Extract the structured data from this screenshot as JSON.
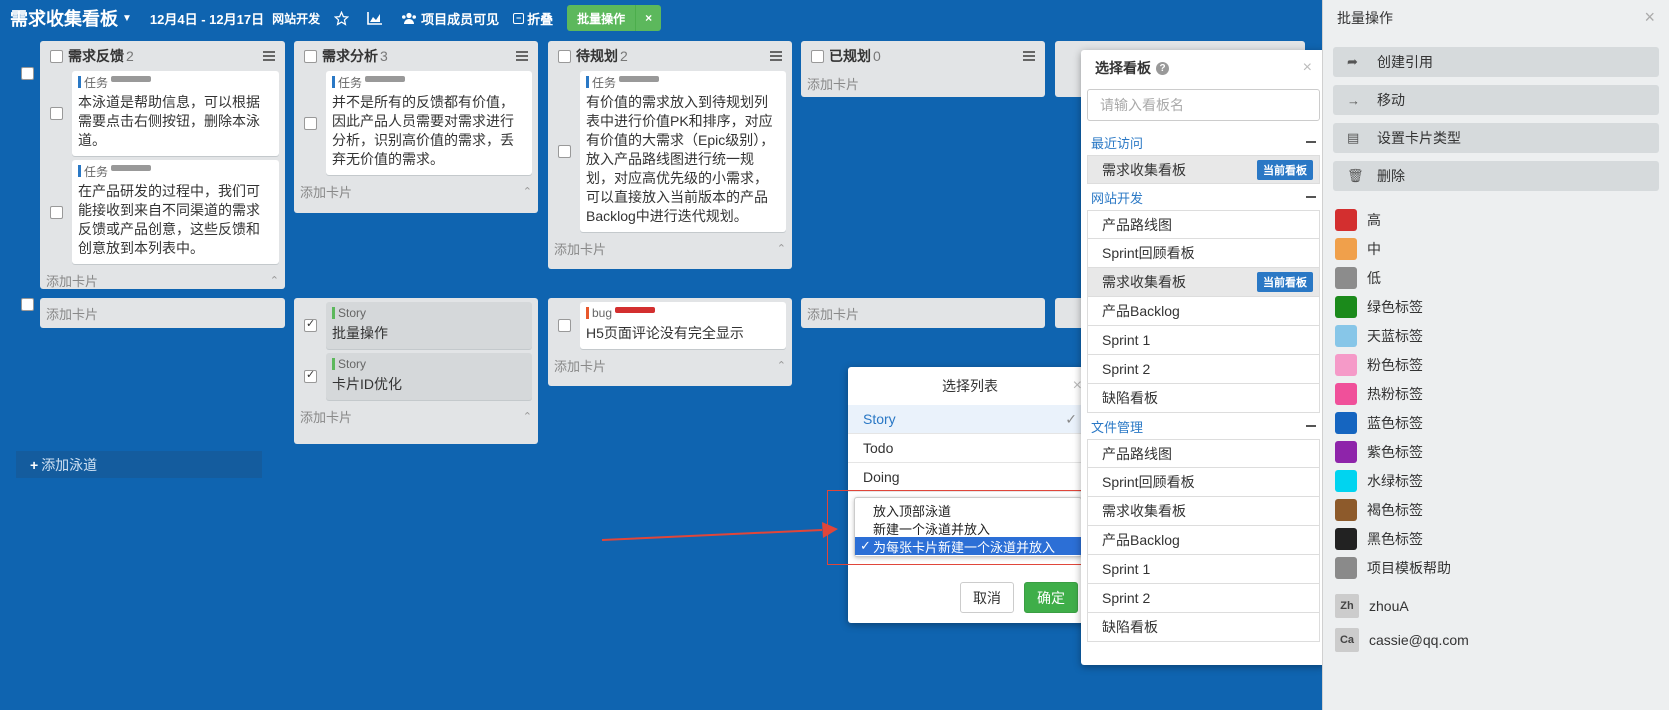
{
  "topbar": {
    "board_title": "需求收集看板",
    "date_range": "12月4日 - 12月17日",
    "project": "网站开发",
    "visibility": "项目成员可见",
    "collapse": "折叠",
    "batch_op": "批量操作",
    "close_batch": "×"
  },
  "lists": [
    {
      "title": "需求反馈",
      "count": "2"
    },
    {
      "title": "需求分析",
      "count": "3"
    },
    {
      "title": "待规划",
      "count": "2"
    },
    {
      "title": "已规划",
      "count": "0"
    }
  ],
  "cards": {
    "fb1": {
      "tag": "任务",
      "text": "本泳道是帮助信息，可以根据需要点击右侧按钮，删除本泳道。"
    },
    "fb2": {
      "tag": "任务",
      "text": "在产品研发的过程中，我们可能接收到来自不同渠道的需求反馈或产品创意，这些反馈和创意放到本列表中。"
    },
    "an1": {
      "tag": "任务",
      "text": "并不是所有的反馈都有价值，因此产品人员需要对需求进行分析，识别高价值的需求，丢弃无价值的需求。"
    },
    "pl1": {
      "tag": "任务",
      "text": "有价值的需求放入到待规划列表中进行价值PK和排序，对应有价值的大需求（Epic级别），放入产品路线图进行统一规划，对应高优先级的小需求，可以直接放入当前版本的产品Backlog中进行迭代规划。"
    },
    "an2": {
      "tag": "Story",
      "text": "批量操作"
    },
    "an3": {
      "tag": "Story",
      "text": "卡片ID优化"
    },
    "pl2": {
      "tag": "bug",
      "text": "H5页面评论没有完全显示"
    }
  },
  "add_card": "添加卡片",
  "add_lane": "添加泳道",
  "board_popup": {
    "title": "选择看板",
    "help": "?",
    "placeholder": "请输入看板名",
    "close": "×",
    "groups": [
      {
        "name": "最近访问",
        "boards": [
          {
            "name": "需求收集看板",
            "badge": "当前看板"
          }
        ]
      },
      {
        "name": "网站开发",
        "boards": [
          {
            "name": "产品路线图"
          },
          {
            "name": "Sprint回顾看板"
          },
          {
            "name": "需求收集看板",
            "badge": "当前看板"
          },
          {
            "name": "产品Backlog"
          },
          {
            "name": "Sprint 1"
          },
          {
            "name": "Sprint 2"
          },
          {
            "name": "缺陷看板"
          }
        ]
      },
      {
        "name": "文件管理",
        "boards": [
          {
            "name": "产品路线图"
          },
          {
            "name": "Sprint回顾看板"
          },
          {
            "name": "需求收集看板"
          },
          {
            "name": "产品Backlog"
          },
          {
            "name": "Sprint 1"
          },
          {
            "name": "Sprint 2"
          },
          {
            "name": "缺陷看板"
          }
        ]
      }
    ]
  },
  "list_dialog": {
    "title": "选择列表",
    "close": "×",
    "options": [
      "Story",
      "Todo",
      "Doing"
    ],
    "selected_option": "Story",
    "lane_choices": [
      "放入顶部泳道",
      "新建一个泳道并放入",
      "为每张卡片新建一个泳道并放入"
    ],
    "lane_selected": "为每张卡片新建一个泳道并放入",
    "cancel": "取消",
    "confirm": "确定"
  },
  "side_panel": {
    "title": "批量操作",
    "close": "×",
    "actions": [
      {
        "label": "创建引用",
        "icon": "share-icon"
      },
      {
        "label": "移动",
        "icon": "arrow-right-icon"
      },
      {
        "label": "设置卡片类型",
        "icon": "card-type-icon"
      },
      {
        "label": "删除",
        "icon": "trash-icon"
      }
    ],
    "labels": [
      {
        "name": "高",
        "color": "#d32f2f"
      },
      {
        "name": "中",
        "color": "#f0a04b"
      },
      {
        "name": "低",
        "color": "#8c8c8c"
      },
      {
        "name": "绿色标签",
        "color": "#1b8a1b"
      },
      {
        "name": "天蓝标签",
        "color": "#87c6e8"
      },
      {
        "name": "粉色标签",
        "color": "#f59ac8"
      },
      {
        "name": "热粉标签",
        "color": "#f0509a"
      },
      {
        "name": "蓝色标签",
        "color": "#1565c0"
      },
      {
        "name": "紫色标签",
        "color": "#8e24aa"
      },
      {
        "name": "水绿标签",
        "color": "#00d4f0"
      },
      {
        "name": "褐色标签",
        "color": "#8d5a2b"
      },
      {
        "name": "黑色标签",
        "color": "#222222"
      },
      {
        "name": "项目模板帮助",
        "color": "#8a8a8a"
      }
    ],
    "members": [
      {
        "initials": "Zh",
        "name": "zhouA"
      },
      {
        "initials": "Ca",
        "name": "cassie@qq.com"
      }
    ]
  },
  "colors": {
    "board_bg": "#0f64b0",
    "accent": "#2a78c5",
    "green": "#5cb85c",
    "highlight": "#e0463a"
  }
}
